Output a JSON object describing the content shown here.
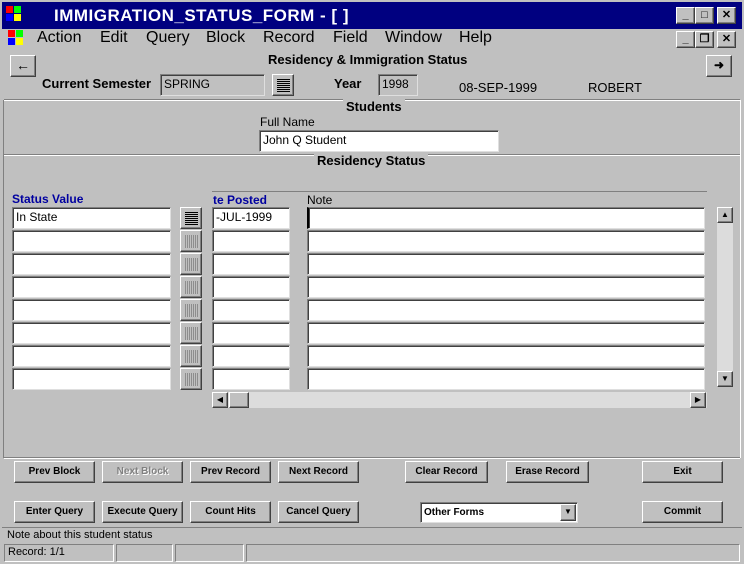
{
  "window": {
    "title": "IMMIGRATION_STATUS_FORM - [ ]",
    "minimize_glyph": "_",
    "maximize_glyph": "□",
    "close_glyph": "✕",
    "restore_glyph": "❐"
  },
  "menu": [
    "Action",
    "Edit",
    "Query",
    "Block",
    "Record",
    "Field",
    "Window",
    "Help"
  ],
  "header": {
    "form_title": "Residency & Immigration Status",
    "semester_label": "Current Semester",
    "semester_value": "SPRING",
    "year_label": "Year",
    "year_value": "1998",
    "date": "08-SEP-1999",
    "user": "ROBERT",
    "back_glyph": "←",
    "forward_glyph": "➜"
  },
  "students": {
    "section_title": "Students",
    "full_name_label": "Full Name",
    "full_name_value": "John Q Student"
  },
  "residency": {
    "section_title": "Residency Status",
    "col_status": "Status Value",
    "col_date": "te Posted",
    "col_note": "Note",
    "rows": [
      {
        "status": "In State",
        "date": "-JUL-1999",
        "note": ""
      },
      {
        "status": "",
        "date": "",
        "note": ""
      },
      {
        "status": "",
        "date": "",
        "note": ""
      },
      {
        "status": "",
        "date": "",
        "note": ""
      },
      {
        "status": "",
        "date": "",
        "note": ""
      },
      {
        "status": "",
        "date": "",
        "note": ""
      },
      {
        "status": "",
        "date": "",
        "note": ""
      },
      {
        "status": "",
        "date": "",
        "note": ""
      }
    ]
  },
  "buttons": {
    "prev_block": "Prev Block",
    "next_block": "Next Block",
    "prev_record": "Prev Record",
    "next_record": "Next Record",
    "clear_record": "Clear Record",
    "erase_record": "Erase Record",
    "exit": "Exit",
    "enter_query": "Enter Query",
    "execute_query": "Execute Query",
    "count_hits": "Count Hits",
    "cancel_query": "Cancel Query",
    "other_forms": "Other Forms",
    "commit": "Commit"
  },
  "status": {
    "message": "Note about this student status",
    "record": "Record: 1/1"
  },
  "colors": {
    "titlebar": "#000080",
    "face": "#c0c0c0",
    "label_blue": "#0000a0"
  }
}
